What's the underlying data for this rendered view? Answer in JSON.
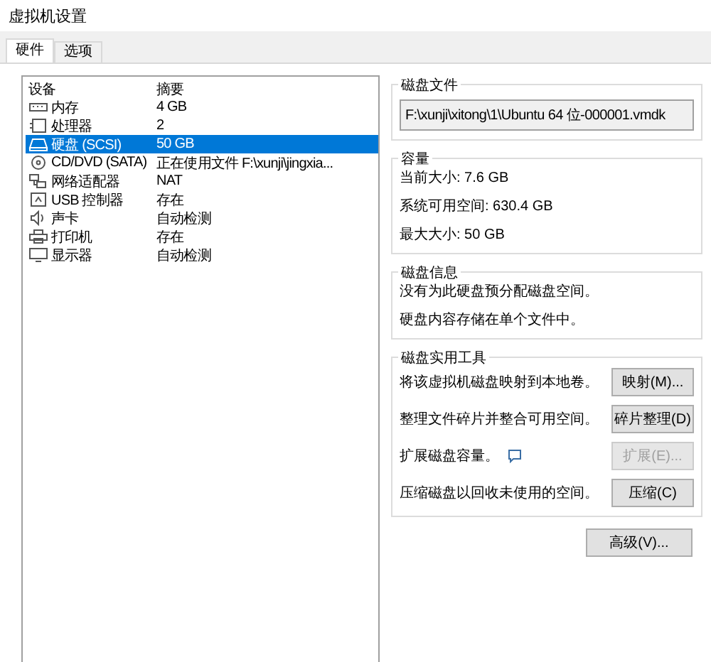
{
  "window": {
    "title": "虚拟机设置"
  },
  "tabs": [
    {
      "label": "硬件",
      "selected": true
    },
    {
      "label": "选项",
      "selected": false
    }
  ],
  "device_list": {
    "columns": [
      "设备",
      "摘要"
    ],
    "rows": [
      {
        "kind": "memory",
        "device": "内存",
        "summary": "4 GB",
        "selected": false
      },
      {
        "kind": "cpu",
        "device": "处理器",
        "summary": "2",
        "selected": false
      },
      {
        "kind": "disk",
        "device": "硬盘 (SCSI)",
        "summary": "50 GB",
        "selected": true
      },
      {
        "kind": "cd",
        "device": "CD/DVD (SATA)",
        "summary": "正在使用文件 F:\\xunji\\jingxia...",
        "selected": false
      },
      {
        "kind": "network",
        "device": "网络适配器",
        "summary": "NAT",
        "selected": false
      },
      {
        "kind": "usb",
        "device": "USB 控制器",
        "summary": "存在",
        "selected": false
      },
      {
        "kind": "sound",
        "device": "声卡",
        "summary": "自动检测",
        "selected": false
      },
      {
        "kind": "printer",
        "device": "打印机",
        "summary": "存在",
        "selected": false
      },
      {
        "kind": "display",
        "device": "显示器",
        "summary": "自动检测",
        "selected": false
      }
    ]
  },
  "disk_file": {
    "title": "磁盘文件",
    "path": "F:\\xunji\\xitong\\1\\Ubuntu 64 位-000001.vmdk"
  },
  "capacity": {
    "title": "容量",
    "lines": [
      "当前大小: 7.6 GB",
      "系统可用空间: 630.4 GB",
      "最大大小: 50 GB"
    ]
  },
  "disk_info": {
    "title": "磁盘信息",
    "lines": [
      "没有为此硬盘预分配磁盘空间。",
      "硬盘内容存储在单个文件中。"
    ]
  },
  "disk_utilities": {
    "title": "磁盘实用工具",
    "items": [
      {
        "text": "将该虚拟机磁盘映射到本地卷。",
        "button": "映射(M)...",
        "disabled": false,
        "info": false
      },
      {
        "text": "整理文件碎片并整合可用空间。",
        "button": "碎片整理(D)",
        "disabled": false,
        "info": false
      },
      {
        "text": "扩展磁盘容量。",
        "button": "扩展(E)...",
        "disabled": true,
        "info": true
      },
      {
        "text": "压缩磁盘以回收未使用的空间。",
        "button": "压缩(C)",
        "disabled": false,
        "info": false
      }
    ]
  },
  "advanced_button": "高级(V)..."
}
